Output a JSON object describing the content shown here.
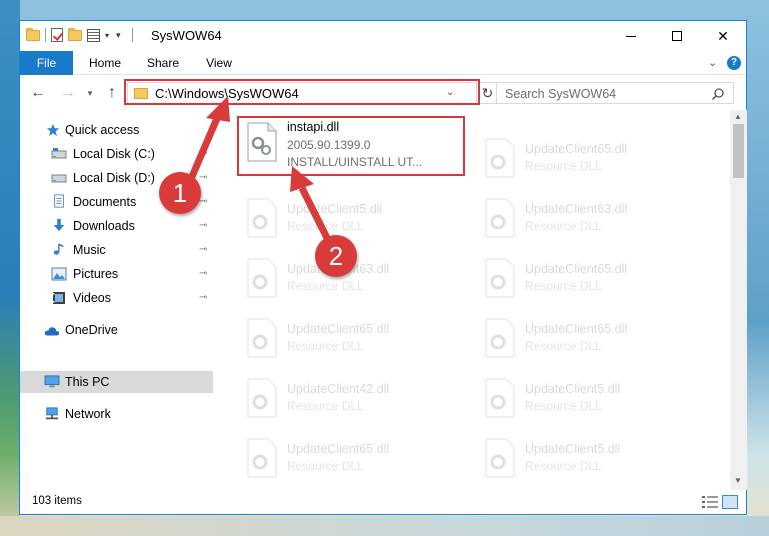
{
  "window": {
    "title": "SysWOW64",
    "controls": {
      "minimize": "minimize-icon",
      "maximize": "maximize-icon",
      "close": "✕"
    }
  },
  "ribbon": {
    "tabs": [
      "File",
      "Home",
      "Share",
      "View"
    ],
    "help": "?"
  },
  "address": {
    "path": "C:\\Windows\\SysWOW64",
    "refresh": "↻"
  },
  "search": {
    "placeholder": "Search SysWOW64"
  },
  "sidebar": {
    "items": [
      {
        "label": "Quick access",
        "icon": "star-icon",
        "pinned": false
      },
      {
        "label": "Local Disk (C:)",
        "icon": "drive-icon",
        "pinned": true
      },
      {
        "label": "Local Disk (D:)",
        "icon": "drive-icon",
        "pinned": true
      },
      {
        "label": "Documents",
        "icon": "documents-icon",
        "pinned": true
      },
      {
        "label": "Downloads",
        "icon": "download-icon",
        "pinned": true
      },
      {
        "label": "Music",
        "icon": "music-icon",
        "pinned": true
      },
      {
        "label": "Pictures",
        "icon": "pictures-icon",
        "pinned": true
      },
      {
        "label": "Videos",
        "icon": "videos-icon",
        "pinned": true
      },
      {
        "label": "OneDrive",
        "icon": "onedrive-icon",
        "pinned": false
      },
      {
        "label": "This PC",
        "icon": "pc-icon",
        "pinned": false,
        "selected": true
      },
      {
        "label": "Network",
        "icon": "network-icon",
        "pinned": false
      }
    ],
    "pin_glyph": "📌"
  },
  "files": {
    "selected": {
      "name": "instapi.dll",
      "version": "2005.90.1399.0",
      "description": "INSTALL/UINSTALL UT..."
    },
    "items": [
      {
        "name": "UpdateClient65.dll",
        "type": "Resource DLL"
      },
      {
        "name": "UpdateClient5.dll",
        "type": "Resource DLL"
      },
      {
        "name": "UpdateClient63.dll",
        "type": "Resource DLL"
      },
      {
        "name": "UpdateClient63.dll",
        "type": "Resource DLL"
      },
      {
        "name": "UpdateClient65.dll",
        "type": "Resource DLL"
      },
      {
        "name": "UpdateClient65.dll",
        "type": "Resource DLL"
      },
      {
        "name": "UpdateClient65.dll",
        "type": "Resource DLL"
      },
      {
        "name": "UpdateClient42.dll",
        "type": "Resource DLL"
      },
      {
        "name": "UpdateClient5.dll",
        "type": "Resource DLL"
      },
      {
        "name": "UpdateClient65.dll",
        "type": "Resource DLL"
      },
      {
        "name": "UpdateClient5.dll",
        "type": "Resource DLL"
      }
    ]
  },
  "status": {
    "count": "103 items"
  },
  "annotations": {
    "step1": "1",
    "step2": "2",
    "color": "#d93a3a"
  }
}
